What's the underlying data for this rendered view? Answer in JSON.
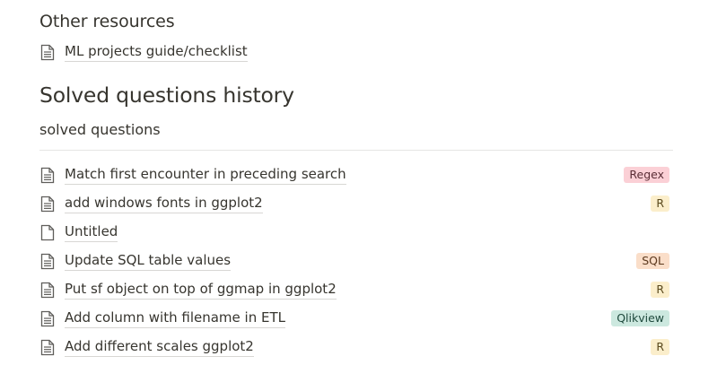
{
  "other_resources": {
    "heading": "Other resources",
    "items": [
      {
        "title": "ML projects guide/checklist",
        "icon": "page-text-icon"
      }
    ]
  },
  "solved_section": {
    "heading": "Solved questions history",
    "database_title": "solved questions",
    "rows": [
      {
        "title": "Match first encounter in preceding search",
        "icon": "page-text-icon",
        "tag": "Regex",
        "tag_bg": "#fbd0d6",
        "tag_fg": "#5a2e36"
      },
      {
        "title": "add windows fonts in ggplot2",
        "icon": "page-text-icon",
        "tag": "R",
        "tag_bg": "#fbeecb",
        "tag_fg": "#5b4a1e"
      },
      {
        "title": "Untitled",
        "icon": "page-empty-icon",
        "tag": "",
        "tag_bg": "",
        "tag_fg": ""
      },
      {
        "title": "Update SQL table values",
        "icon": "page-text-icon",
        "tag": "SQL",
        "tag_bg": "#fadec9",
        "tag_fg": "#5d3a1f"
      },
      {
        "title": "Put sf object on top of ggmap in ggplot2",
        "icon": "page-text-icon",
        "tag": "R",
        "tag_bg": "#fbeecb",
        "tag_fg": "#5b4a1e"
      },
      {
        "title": "Add column with filename in ETL",
        "icon": "page-text-icon",
        "tag": "Qlikview",
        "tag_bg": "#cce8df",
        "tag_fg": "#1f4a3d"
      },
      {
        "title": "Add different scales ggplot2",
        "icon": "page-text-icon",
        "tag": "R",
        "tag_bg": "#fbeecb",
        "tag_fg": "#5b4a1e"
      }
    ]
  }
}
